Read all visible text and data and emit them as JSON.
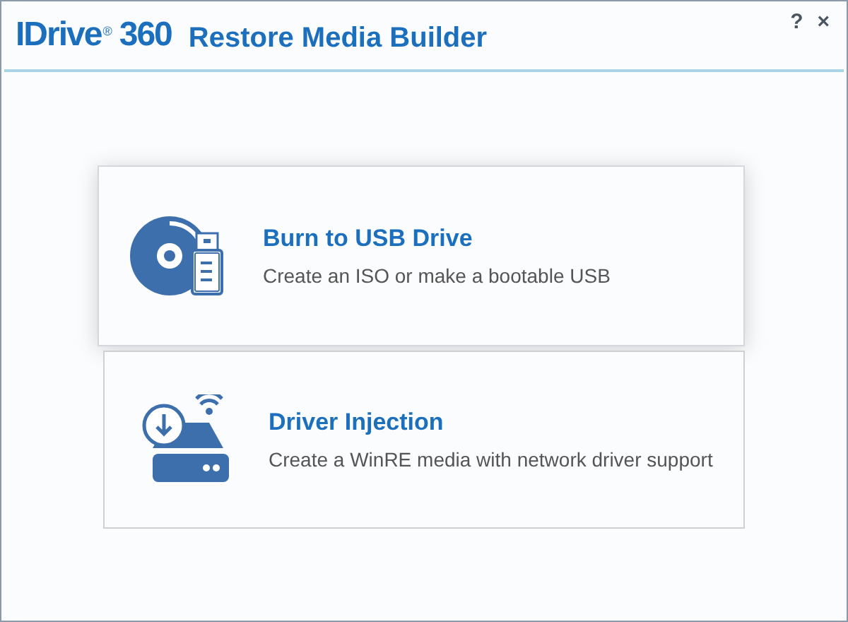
{
  "header": {
    "logo": {
      "name": "IDrive",
      "mark": "®",
      "suffix": "360"
    },
    "title": "Restore Media Builder",
    "help": "?",
    "close": "×"
  },
  "options": [
    {
      "kind": "usb",
      "title": "Burn to USB Drive",
      "description": "Create an ISO or make a bootable USB",
      "selected": true
    },
    {
      "kind": "driver",
      "title": "Driver Injection",
      "description": "Create a WinRE media with network driver support",
      "selected": false
    }
  ]
}
